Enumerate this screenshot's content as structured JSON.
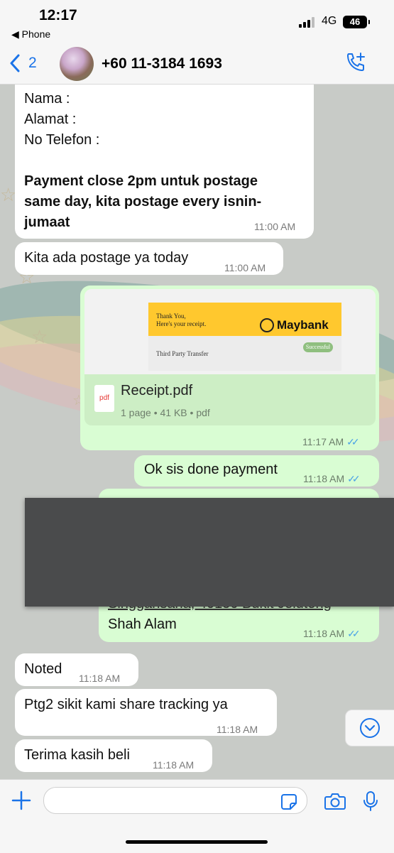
{
  "status_bar": {
    "time": "12:17",
    "back_app": "◀ Phone",
    "network": "4G",
    "battery": "46"
  },
  "header": {
    "back_count": "2",
    "contact_name": "+60 11-3184 1693"
  },
  "messages": [
    {
      "direction": "incoming",
      "lines": [
        "Nama :",
        "Alamat :",
        "No Telefon :"
      ],
      "bold_text": "Payment close 2pm untuk postage same day, kita postage every isnin-jumaat",
      "time": "11:00 AM"
    },
    {
      "direction": "incoming",
      "text": "Kita ada postage ya today",
      "time": "11:00 AM"
    },
    {
      "direction": "outgoing",
      "receipt_preview": {
        "thanks_line1": "Thank You,",
        "thanks_line2": "Here's your receipt.",
        "bank": "Maybank",
        "transfer": "Third Party Transfer",
        "status": "Successful"
      },
      "file_icon": "pdf",
      "file_name": "Receipt.pdf",
      "file_meta": "1 page • 41 KB • pdf",
      "time": "11:17 AM"
    },
    {
      "direction": "outgoing",
      "text": "Ok sis done payment",
      "time": "11:18 AM"
    },
    {
      "direction": "outgoing",
      "partial_text": "Singgahsana, 40150 Bukit Jelutong",
      "text": "Shah Alam",
      "time": "11:18 AM"
    },
    {
      "direction": "incoming",
      "text": "Noted",
      "time": "11:18 AM"
    },
    {
      "direction": "incoming",
      "text": "Ptg2 sikit kami share tracking ya",
      "time": "11:18 AM"
    },
    {
      "direction": "incoming",
      "text": "Terima kasih beli",
      "time": "11:18 AM"
    }
  ],
  "icons": [
    "chevron-left-icon",
    "add-call-icon",
    "plus-icon",
    "sticker-icon",
    "camera-icon",
    "microphone-icon",
    "chevron-down-icon",
    "read-ticks-icon",
    "pdf-icon"
  ],
  "colors": {
    "accent": "#1a73e8",
    "outgoing_bubble": "#d9fdd3",
    "incoming_bubble": "#ffffff",
    "read_ticks": "#4aa3e6"
  }
}
